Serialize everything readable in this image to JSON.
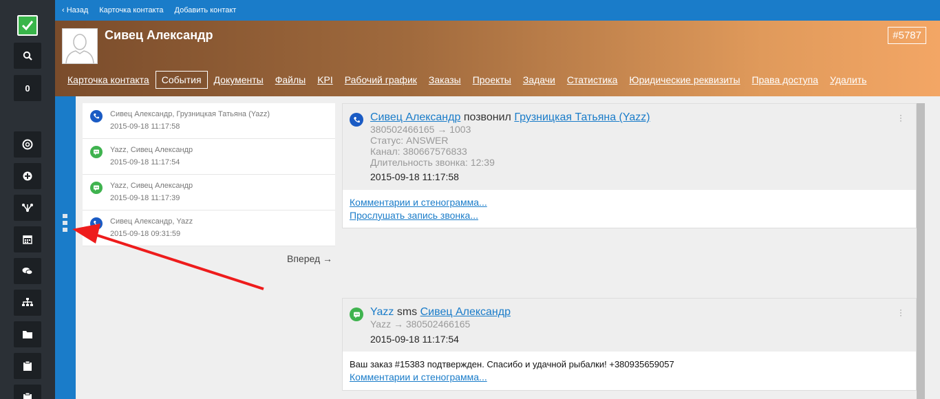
{
  "sidebar": {
    "counter": "0",
    "icons": [
      "check-icon",
      "search-icon",
      "lifebuoy-icon",
      "plus-circle-icon",
      "branch-icon",
      "calendar-icon",
      "chat-icon",
      "org-chart-icon",
      "folder-icon",
      "clipboard-icon",
      "clipboard-icon"
    ]
  },
  "topbar": {
    "back": "‹ Назад",
    "contact_card": "Карточка контакта",
    "add_contact": "Добавить контакт"
  },
  "header": {
    "name": "Сивец Александр",
    "id": "#5787",
    "tabs": [
      "Карточка контакта",
      "События",
      "Документы",
      "Файлы",
      "KPI",
      "Рабочий график",
      "Заказы",
      "Проекты",
      "Задачи",
      "Статистика",
      "Юридические реквизиты",
      "Права доступа",
      "Удалить"
    ],
    "active_tab": "События"
  },
  "events": [
    {
      "type": "call",
      "title": "Сивец Александр, Грузницкая Татьяна (Yazz)",
      "date": "2015-09-18 11:17:58"
    },
    {
      "type": "sms",
      "title": "Yazz, Сивец Александр",
      "date": "2015-09-18 11:17:54"
    },
    {
      "type": "sms",
      "title": "Yazz, Сивец Александр",
      "date": "2015-09-18 11:17:39"
    },
    {
      "type": "call",
      "title": "Сивец Александр, Yazz",
      "date": "2015-09-18 09:31:59"
    }
  ],
  "next_label": "Вперед →",
  "detail_call": {
    "caller": "Сивец Александр",
    "verb": "позвонил",
    "callee": "Грузницкая Татьяна (Yazz)",
    "numbers": "380502466165 → 1003",
    "status": "Статус: ANSWER",
    "channel": "Канал: 380667576833",
    "duration": "Длительность звонка: 12:39",
    "date": "2015-09-18 11:17:58",
    "comments_link": "Комментарии и стенограмма...",
    "listen_link": "Прослушать запись звонка..."
  },
  "detail_sms": {
    "sender": "Yazz",
    "verb": "sms",
    "recipient": "Сивец Александр",
    "numbers": "Yazz → 380502466165",
    "date": "2015-09-18 11:17:54",
    "message": "Ваш заказ #15383 подтвержден. Спасибо и удачной рыбалки! +380935659057",
    "comments_link": "Комментарии и стенограмма..."
  },
  "colors": {
    "topbar": "#1a7cc9",
    "sidebar": "#2b3036",
    "call_icon": "#1a5bc4",
    "sms_icon": "#3fb34f",
    "link": "#1a7cc9"
  }
}
